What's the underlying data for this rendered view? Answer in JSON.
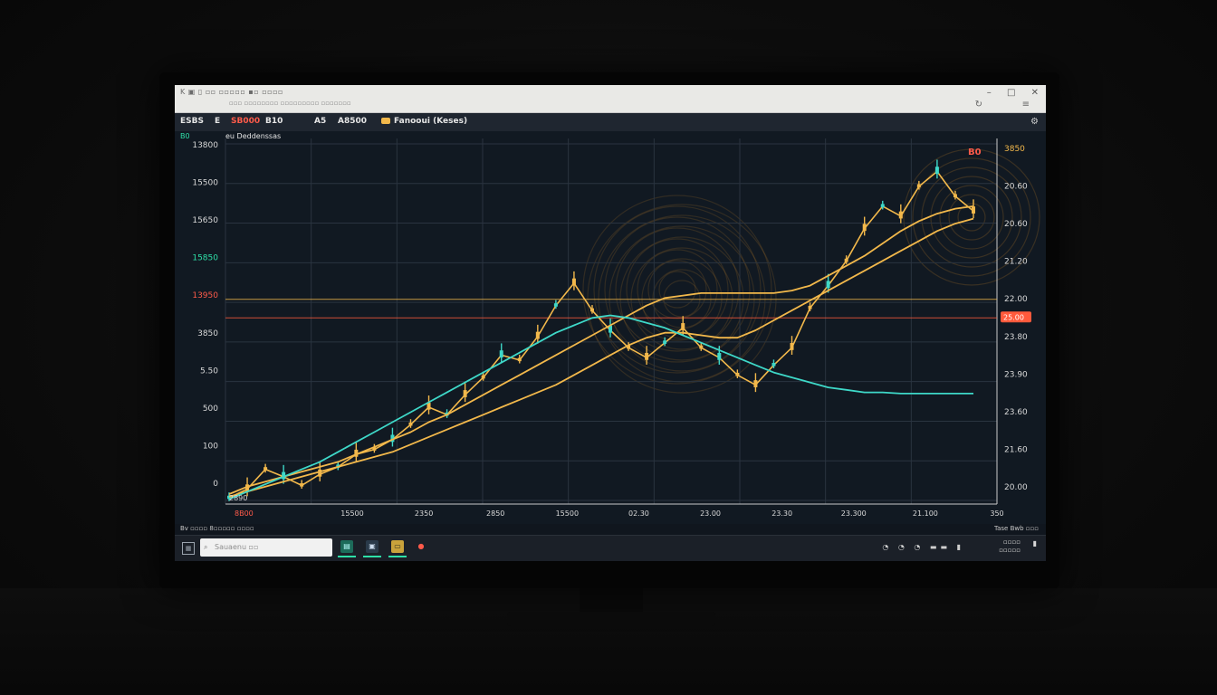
{
  "browser": {
    "tabs_text": "K ▣ ▯ ▫▫ ▫▫▫▫▫ ▪▫ ▫▫▫▫",
    "url_text": "▫▫▫ ▫▫▫▫▫▫▫▫ ▫▫▫▫▫▫▫▫▫ ▫▫▫▫▫▫▫",
    "minimize": "–",
    "maximize": "□",
    "close": "✕",
    "reload": "↻",
    "menu": "≡"
  },
  "toolbar": {
    "symbol": "ESBS",
    "item_1": "E",
    "price_badge": "SB000",
    "item_3": "B10",
    "item_4": "A5",
    "item_5": "A8500",
    "indicator": "Fanooui (Keses)",
    "sub_left": "B0",
    "sub_symbol": "eu Deddenssas"
  },
  "chart_data": {
    "type": "line",
    "left_axis_labels": [
      "13800",
      "15500",
      "15650",
      "15850",
      "13950",
      "3850",
      "5.50",
      "500",
      "100",
      "0"
    ],
    "right_axis_labels": [
      "3850",
      "20.60",
      "20.60",
      "21.20",
      "22.00",
      "23.80",
      "23.90",
      "23.60",
      "21.60",
      "20.00"
    ],
    "right_axis_highlight": "25.00",
    "x_axis_labels": [
      "15500",
      "2350",
      "2850",
      "15500",
      "02.30",
      "23.00",
      "23.30",
      "23.300",
      "21.100",
      "350"
    ],
    "x_start_label": "8B00",
    "last_price_label": "B0",
    "bottom_left_label": "2890",
    "series": [
      {
        "color": "#f2b84b",
        "y": [
          5,
          12,
          28,
          22,
          15,
          24,
          30,
          40,
          44,
          52,
          64,
          78,
          72,
          88,
          102,
          120,
          116,
          135,
          160,
          178,
          156,
          140,
          126,
          118,
          130,
          142,
          126,
          118,
          104,
          96,
          112,
          126,
          158,
          176,
          196,
          222,
          240,
          232,
          256,
          268,
          248,
          236
        ]
      },
      {
        "color": "#f2b84b",
        "y": [
          8,
          14,
          18,
          22,
          26,
          30,
          34,
          40,
          46,
          52,
          58,
          66,
          72,
          80,
          88,
          96,
          104,
          112,
          120,
          128,
          136,
          144,
          152,
          160,
          166,
          168,
          170,
          170,
          170,
          170,
          170,
          172,
          176,
          184,
          192,
          200,
          210,
          220,
          228,
          234,
          238,
          240
        ]
      },
      {
        "color": "#f2b84b",
        "y": [
          6,
          10,
          14,
          18,
          22,
          26,
          30,
          34,
          38,
          42,
          48,
          54,
          60,
          66,
          72,
          78,
          84,
          90,
          96,
          104,
          112,
          120,
          128,
          134,
          138,
          138,
          136,
          134,
          134,
          140,
          148,
          156,
          164,
          172,
          180,
          188,
          196,
          204,
          212,
          220,
          226,
          230
        ]
      },
      {
        "color": "#3ed8c8",
        "y": [
          4,
          10,
          16,
          22,
          28,
          34,
          42,
          50,
          58,
          66,
          74,
          82,
          90,
          98,
          106,
          114,
          122,
          130,
          138,
          144,
          150,
          152,
          150,
          146,
          142,
          136,
          130,
          124,
          118,
          112,
          106,
          102,
          98,
          94,
          92,
          90,
          90,
          89,
          89,
          89,
          89,
          89
        ]
      }
    ],
    "y_range": [
      0,
      280
    ],
    "reference_lines": [
      {
        "color": "#ff5a3c",
        "value": 150
      },
      {
        "color": "#f2b84b",
        "value": 165
      }
    ]
  },
  "bottom_strip": {
    "left_text": "Bv ▫▫▫▫ 8▫▫▫▫▫ ▫▫▫▫",
    "right_text": "Tase Bwb ▫▫▫"
  },
  "taskbar": {
    "search_placeholder": "Sauaenu ▫▫",
    "time_line1": "▫▫▫▫",
    "time_line2": "▫▫▫▫▫",
    "tray": "◔ ◔ ◔ ▬▬ ▮"
  }
}
